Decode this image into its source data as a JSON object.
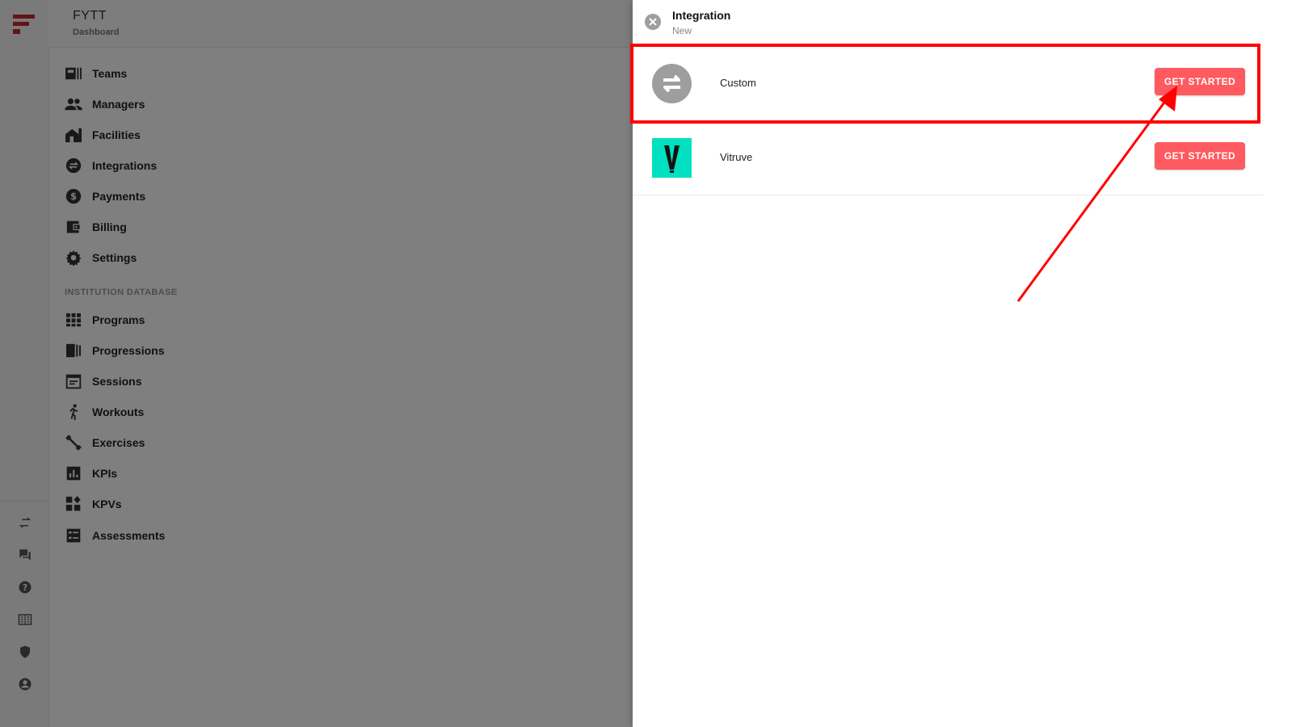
{
  "app": {
    "title": "FYTT",
    "subtitle": "Dashboard"
  },
  "nav": {
    "items": [
      {
        "label": "Teams",
        "icon": "teams-icon"
      },
      {
        "label": "Managers",
        "icon": "managers-icon"
      },
      {
        "label": "Facilities",
        "icon": "facilities-icon"
      },
      {
        "label": "Integrations",
        "icon": "integrations-icon"
      },
      {
        "label": "Payments",
        "icon": "payments-icon"
      },
      {
        "label": "Billing",
        "icon": "billing-icon"
      },
      {
        "label": "Settings",
        "icon": "settings-icon"
      }
    ],
    "section_title": "INSTITUTION DATABASE",
    "db_items": [
      {
        "label": "Programs",
        "icon": "programs-icon"
      },
      {
        "label": "Progressions",
        "icon": "progressions-icon"
      },
      {
        "label": "Sessions",
        "icon": "sessions-icon"
      },
      {
        "label": "Workouts",
        "icon": "workouts-icon"
      },
      {
        "label": "Exercises",
        "icon": "exercises-icon"
      },
      {
        "label": "KPIs",
        "icon": "kpis-icon"
      },
      {
        "label": "KPVs",
        "icon": "kpvs-icon"
      },
      {
        "label": "Assessments",
        "icon": "assessments-icon"
      }
    ]
  },
  "drawer": {
    "title": "Integration",
    "subtitle": "New",
    "rows": [
      {
        "label": "Custom",
        "button": "GET STARTED",
        "icon": "swap-arrows-icon"
      },
      {
        "label": "Vitruve",
        "button": "GET STARTED",
        "icon": "vitruve-logo"
      }
    ]
  },
  "colors": {
    "accent": "#ff5a5f",
    "highlight": "#ff0000",
    "vitruve": "#00e0c0",
    "brand": "#c62828"
  }
}
